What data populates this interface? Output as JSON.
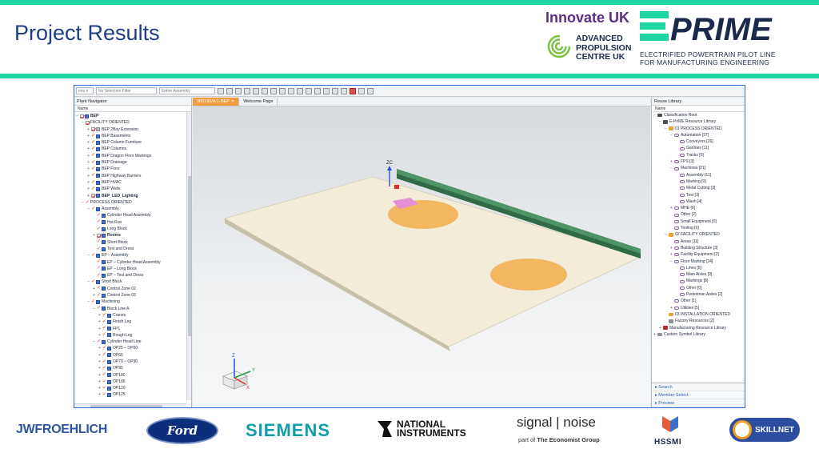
{
  "header": {
    "title": "Project Results",
    "innovate_uk": "Innovate UK",
    "apc": "ADVANCED PROPULSION CENTRE UK",
    "eprime_logo": "E-PRIME",
    "eprime_sub_1": "ELECTRIFIED POWERTRAIN PILOT LINE",
    "eprime_sub_2": "FOR MANUFACTURING ENGINEERING"
  },
  "toolbar": {
    "menu": "enu ▾",
    "selection_filter": "No Selection Filter",
    "assembly": "Entire Assembly"
  },
  "plant_navigator": {
    "title": "Plant Navigator",
    "col_name": "Name",
    "rows": [
      {
        "indent": 0,
        "exp": "−",
        "mark": "chk",
        "label": "BEP",
        "cube": "blue",
        "bold": true
      },
      {
        "indent": 1,
        "exp": "−",
        "mark": "chk",
        "label": "FACILITY ORIENTED",
        "cube": "none"
      },
      {
        "indent": 2,
        "exp": "+",
        "mark": "chk",
        "label": "BEP 2Bay Extension",
        "cube": "gray"
      },
      {
        "indent": 2,
        "exp": "+",
        "mark": "tick",
        "label": "BEP Basements",
        "cube": "blue"
      },
      {
        "indent": 2,
        "exp": "+",
        "mark": "tick",
        "label": "BEP Column Furniture",
        "cube": "blue"
      },
      {
        "indent": 2,
        "exp": "+",
        "mark": "tick",
        "label": "BEP Columns",
        "cube": "blue"
      },
      {
        "indent": 2,
        "exp": "+",
        "mark": "tick",
        "label": "BEP Dragon Floor Markings",
        "cube": "blue"
      },
      {
        "indent": 2,
        "exp": "+",
        "mark": "tick",
        "label": "BEP Drainage",
        "cube": "blue"
      },
      {
        "indent": 2,
        "exp": "+",
        "mark": "tick",
        "label": "BEP Floor",
        "cube": "blue"
      },
      {
        "indent": 2,
        "exp": "+",
        "mark": "tick",
        "label": "BEP Highway Barriers",
        "cube": "blue"
      },
      {
        "indent": 2,
        "exp": "+",
        "mark": "tick",
        "label": "BEP HVAC",
        "cube": "blue"
      },
      {
        "indent": 2,
        "exp": "+",
        "mark": "tick",
        "label": "BEP Walls",
        "cube": "blue"
      },
      {
        "indent": 2,
        "exp": "+",
        "mark": "chk",
        "label": "BEP_LED_Lighting",
        "cube": "blue",
        "bold": true
      },
      {
        "indent": 1,
        "exp": "−",
        "mark": "tick",
        "label": "PROCESS ORIENTED",
        "cube": "none"
      },
      {
        "indent": 2,
        "exp": "−",
        "mark": "tick",
        "label": "Assembly",
        "cube": "blue"
      },
      {
        "indent": 3,
        "exp": "",
        "mark": "tick",
        "label": "Cylinder Head Assembly",
        "cube": "blue"
      },
      {
        "indent": 3,
        "exp": "",
        "mark": "tick",
        "label": "Hot Run",
        "cube": "blue"
      },
      {
        "indent": 3,
        "exp": "",
        "mark": "tick",
        "label": "Long Block",
        "cube": "blue"
      },
      {
        "indent": 3,
        "exp": "+",
        "mark": "chk",
        "label": "Rooms",
        "cube": "blue",
        "bold": true
      },
      {
        "indent": 3,
        "exp": "",
        "mark": "tick",
        "label": "Short Block",
        "cube": "blue"
      },
      {
        "indent": 3,
        "exp": "",
        "mark": "tick",
        "label": "Test and Dress",
        "cube": "blue"
      },
      {
        "indent": 2,
        "exp": "−",
        "mark": "tick",
        "label": "EP – Assembly",
        "cube": "blue"
      },
      {
        "indent": 3,
        "exp": "",
        "mark": "tick",
        "label": "EP – Cylinder Head Assembly",
        "cube": "blue"
      },
      {
        "indent": 3,
        "exp": "",
        "mark": "tick",
        "label": "EP – Long Block",
        "cube": "blue"
      },
      {
        "indent": 3,
        "exp": "",
        "mark": "tick",
        "label": "EP – Test and Dress",
        "cube": "blue"
      },
      {
        "indent": 2,
        "exp": "−",
        "mark": "tick",
        "label": "Short Block",
        "cube": "blue"
      },
      {
        "indent": 3,
        "exp": "+",
        "mark": "tick",
        "label": "Control Zone 02",
        "cube": "blue"
      },
      {
        "indent": 3,
        "exp": "+",
        "mark": "tick",
        "label": "Control Zone 03",
        "cube": "blue"
      },
      {
        "indent": 2,
        "exp": "−",
        "mark": "tick",
        "label": "Machining",
        "cube": "blue"
      },
      {
        "indent": 3,
        "exp": "−",
        "mark": "tick",
        "label": "Block Line A",
        "cube": "blue"
      },
      {
        "indent": 4,
        "exp": "+",
        "mark": "tick",
        "label": "Cranes",
        "cube": "blue"
      },
      {
        "indent": 4,
        "exp": "+",
        "mark": "tick",
        "label": "Finish Leg",
        "cube": "blue"
      },
      {
        "indent": 4,
        "exp": "+",
        "mark": "tick",
        "label": "FP1",
        "cube": "blue"
      },
      {
        "indent": 4,
        "exp": "+",
        "mark": "tick",
        "label": "Rough Leg",
        "cube": "blue"
      },
      {
        "indent": 3,
        "exp": "−",
        "mark": "tick",
        "label": "Cylinder Head Line",
        "cube": "blue"
      },
      {
        "indent": 4,
        "exp": "+",
        "mark": "tick",
        "label": "OP25 – OP60",
        "cube": "blue"
      },
      {
        "indent": 4,
        "exp": "+",
        "mark": "tick",
        "label": "OP65",
        "cube": "blue"
      },
      {
        "indent": 4,
        "exp": "+",
        "mark": "tick",
        "label": "OP70 – OP90",
        "cube": "blue"
      },
      {
        "indent": 4,
        "exp": "+",
        "mark": "tick",
        "label": "OP95",
        "cube": "blue"
      },
      {
        "indent": 4,
        "exp": "+",
        "mark": "tick",
        "label": "OP100",
        "cube": "blue"
      },
      {
        "indent": 4,
        "exp": "+",
        "mark": "tick",
        "label": "OP105",
        "cube": "blue"
      },
      {
        "indent": 4,
        "exp": "+",
        "mark": "tick",
        "label": "OP120",
        "cube": "blue"
      },
      {
        "indent": 4,
        "exp": "+",
        "mark": "tick",
        "label": "OP125",
        "cube": "blue"
      }
    ]
  },
  "viewport": {
    "tab_active": "000190/A;1-BEP",
    "tab_welcome": "Welcome Page",
    "axis_zc": "ZC",
    "axis_x": "X",
    "axis_y": "Y",
    "axis_z": "Z"
  },
  "reuse_library": {
    "title": "Reuse Library",
    "col_name": "Name",
    "rows": [
      {
        "indent": 0,
        "exp": "−",
        "icon": "fold-dark",
        "label": "Classification Root"
      },
      {
        "indent": 1,
        "exp": "−",
        "icon": "fold-dark",
        "label": "E-PriME Resource Library"
      },
      {
        "indent": 2,
        "exp": "−",
        "icon": "fold",
        "label": "01 PROCESS ORIENTED"
      },
      {
        "indent": 3,
        "exp": "−",
        "icon": "chain",
        "label": "Automation [37]"
      },
      {
        "indent": 4,
        "exp": "",
        "icon": "chain",
        "label": "Conveyors [26]"
      },
      {
        "indent": 4,
        "exp": "",
        "icon": "chain",
        "label": "Gantries [11]"
      },
      {
        "indent": 4,
        "exp": "",
        "icon": "chain",
        "label": "Tracks [0]"
      },
      {
        "indent": 3,
        "exp": "+",
        "icon": "chain",
        "label": "FPS [3]"
      },
      {
        "indent": 3,
        "exp": "−",
        "icon": "chain",
        "label": "Machines [21]"
      },
      {
        "indent": 4,
        "exp": "",
        "icon": "chain",
        "label": "Assembly [11]"
      },
      {
        "indent": 4,
        "exp": "",
        "icon": "chain",
        "label": "Marking [0]"
      },
      {
        "indent": 4,
        "exp": "",
        "icon": "chain",
        "label": "Metal Cutting [3]"
      },
      {
        "indent": 4,
        "exp": "",
        "icon": "chain",
        "label": "Test [3]"
      },
      {
        "indent": 4,
        "exp": "",
        "icon": "chain",
        "label": "Wash [4]"
      },
      {
        "indent": 3,
        "exp": "+",
        "icon": "chain",
        "label": "MHE [6]"
      },
      {
        "indent": 3,
        "exp": "",
        "icon": "chain",
        "label": "Other [2]"
      },
      {
        "indent": 3,
        "exp": "",
        "icon": "chain",
        "label": "Small Equipment [0]"
      },
      {
        "indent": 3,
        "exp": "",
        "icon": "chain",
        "label": "Tooling [0]"
      },
      {
        "indent": 2,
        "exp": "−",
        "icon": "fold",
        "label": "02 FACILITY ORIENTED"
      },
      {
        "indent": 3,
        "exp": "",
        "icon": "chain",
        "label": "Areas [11]"
      },
      {
        "indent": 3,
        "exp": "+",
        "icon": "chain",
        "label": "Building Structure [3]"
      },
      {
        "indent": 3,
        "exp": "+",
        "icon": "chain",
        "label": "Facility Equipment [2]"
      },
      {
        "indent": 3,
        "exp": "−",
        "icon": "chain",
        "label": "Floor Marking [24]"
      },
      {
        "indent": 4,
        "exp": "",
        "icon": "chain",
        "label": "Lines [5]"
      },
      {
        "indent": 4,
        "exp": "",
        "icon": "chain",
        "label": "Main Aisles [9]"
      },
      {
        "indent": 4,
        "exp": "",
        "icon": "chain",
        "label": "Markings [8]"
      },
      {
        "indent": 4,
        "exp": "",
        "icon": "chain",
        "label": "Other [0]"
      },
      {
        "indent": 4,
        "exp": "",
        "icon": "chain",
        "label": "Pedestrian Aisles [2]"
      },
      {
        "indent": 3,
        "exp": "",
        "icon": "chain",
        "label": "Other [1]"
      },
      {
        "indent": 3,
        "exp": "+",
        "icon": "chain",
        "label": "Utilities [5]"
      },
      {
        "indent": 2,
        "exp": "",
        "icon": "fold",
        "label": "03 INSTALLATION ORIENTED"
      },
      {
        "indent": 2,
        "exp": "",
        "icon": "fold-gray",
        "label": "Factory Resources [2]"
      },
      {
        "indent": 1,
        "exp": "+",
        "icon": "fold-red",
        "label": "Manufacturing Resource Library"
      },
      {
        "indent": 0,
        "exp": "+",
        "icon": "fold-gray",
        "label": "Custom Symbol Library"
      }
    ],
    "footer": [
      "Search",
      "Member Select",
      "Preview"
    ]
  },
  "partners": {
    "jwf": "JWFROEHLICH",
    "ford": "Ford",
    "siemens": "SIEMENS",
    "ni_1": "NATIONAL",
    "ni_2": "INSTRUMENTS",
    "signal": "signal | noise",
    "signal_sub_a": "part of ",
    "signal_sub_b": "The Economist Group",
    "hssmi": "HSSMI",
    "skillnet": "SKILLNET"
  },
  "colors": {
    "accent": "#1fd6a2",
    "title": "#1f3e82",
    "tab_active": "#f39c3c"
  }
}
